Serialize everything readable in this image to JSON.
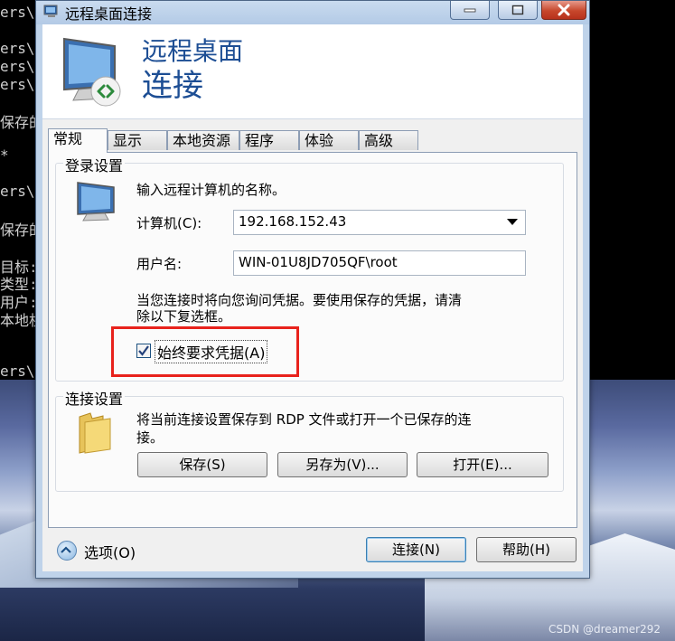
{
  "console": {
    "lines": [
      "ers\\",
      "ers\\",
      "ers\\",
      "ers\\",
      "保存的",
      "*",
      "ers\\",
      "保存的",
      "目标:",
      "类型:",
      "用户:",
      "本地机",
      "ers\\"
    ]
  },
  "window": {
    "title": "远程桌面连接",
    "header_line1": "远程桌面",
    "header_line2": "连接"
  },
  "tabs": [
    "常规",
    "显示",
    "本地资源",
    "程序",
    "体验",
    "高级"
  ],
  "login_group": {
    "legend": "登录设置",
    "instruction": "输入远程计算机的名称。",
    "computer_label": "计算机(C):",
    "computer_value": "192.168.152.43",
    "username_label": "用户名:",
    "username_value": "WIN-01U8JD705QF\\root",
    "note_line1": "当您连接时将向您询问凭据。要使用保存的凭据，请清",
    "note_line2": "除以下复选框。",
    "checkbox_label": "始终要求凭据(A)",
    "checkbox_checked": true
  },
  "connect_group": {
    "legend": "连接设置",
    "desc_line1": "将当前连接设置保存到 RDP 文件或打开一个已保存的连",
    "desc_line2": "接。",
    "save_label": "保存(S)",
    "save_as_label": "另存为(V)...",
    "open_label": "打开(E)..."
  },
  "footer": {
    "options_label": "选项(O)",
    "connect_label": "连接(N)",
    "help_label": "帮助(H)"
  },
  "watermark": "CSDN @dreamer292",
  "colors": {
    "title_blue": "#1d4e94",
    "highlight_red": "#e8221c"
  }
}
